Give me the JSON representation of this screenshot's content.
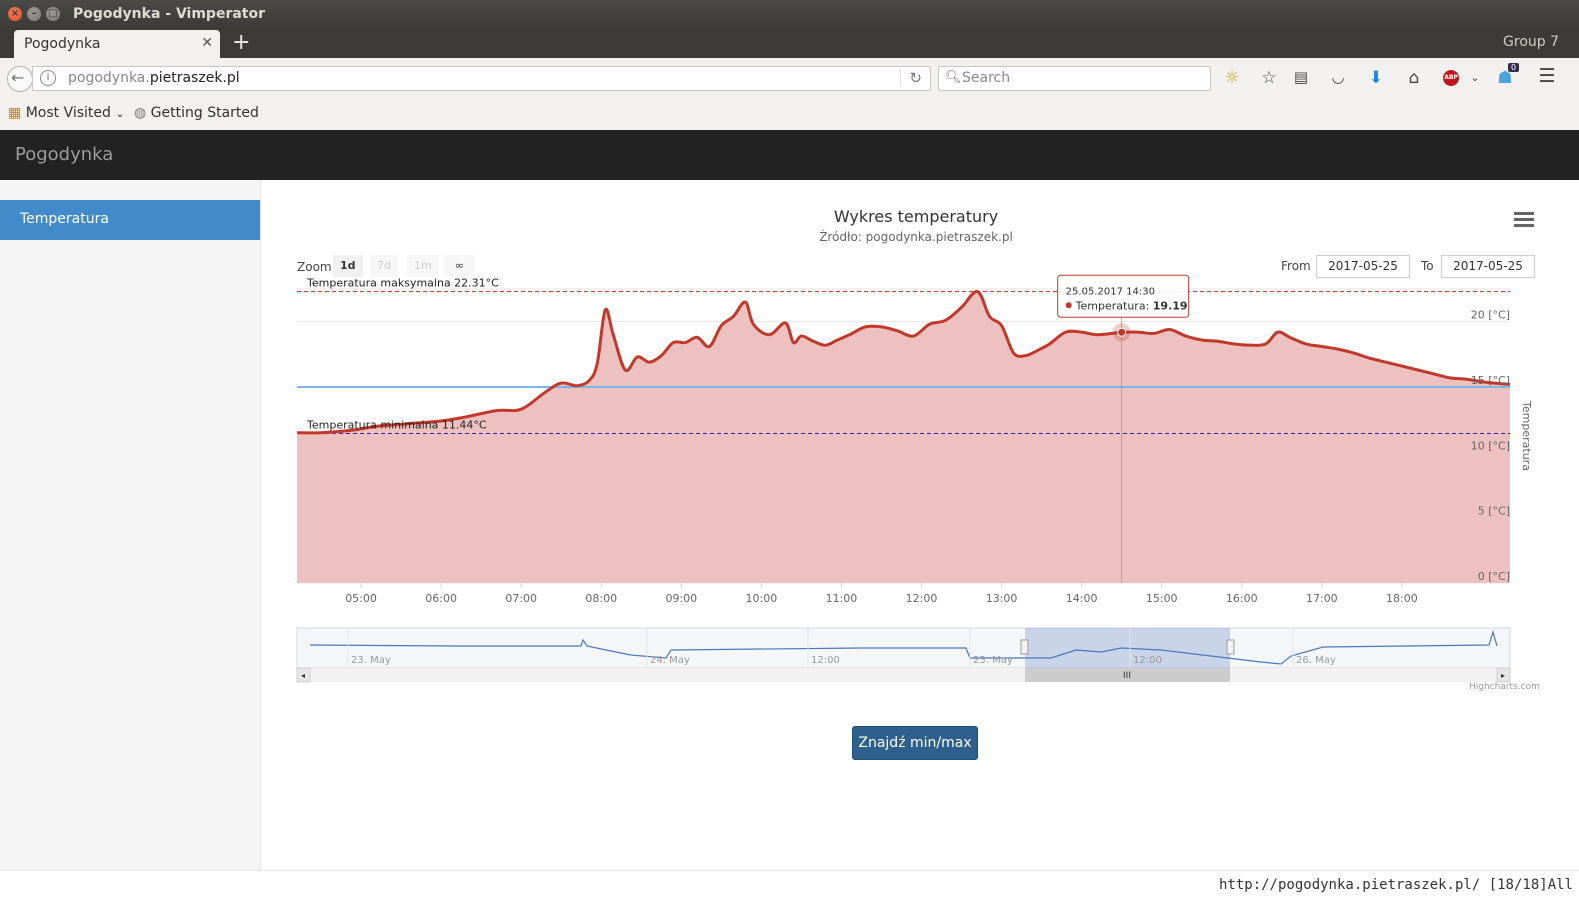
{
  "window": {
    "title": "Pogodynka - Vimperator"
  },
  "tabs": {
    "active_label": "Pogodynka",
    "group_label": "Group 7"
  },
  "nav": {
    "url_prefix": "pogodynka.",
    "url_domain": "pietraszek.pl",
    "search_placeholder": "Search",
    "downloads_badge": "0"
  },
  "bookmarks": {
    "most_visited": "Most Visited",
    "getting_started": "Getting Started"
  },
  "app": {
    "brand": "Pogodynka",
    "sidebar_items": [
      {
        "label": "Temperatura",
        "active": true
      }
    ],
    "find_button": "Znajdź min/max"
  },
  "chart_controls": {
    "zoom_label": "Zoom",
    "zoom_buttons": [
      "1d",
      "7d",
      "1m",
      "∞"
    ],
    "zoom_selected": "1d",
    "from_label": "From",
    "from_value": "2017-05-25",
    "to_label": "To",
    "to_value": "2017-05-25"
  },
  "chart_data": {
    "type": "area",
    "title": "Wykres temperatury",
    "subtitle": "Źródło: pogodynka.pietraszek.pl",
    "ylabel": "Temperatura",
    "ylim": [
      0,
      22.5
    ],
    "y_ticks": [
      "0 [°C]",
      "5 [°C]",
      "10 [°C]",
      "15 [°C]",
      "20 [°C]"
    ],
    "y_tick_values": [
      0,
      5,
      10,
      15,
      20
    ],
    "x_ticks": [
      "05:00",
      "06:00",
      "07:00",
      "08:00",
      "09:00",
      "10:00",
      "11:00",
      "12:00",
      "13:00",
      "14:00",
      "15:00",
      "16:00",
      "17:00",
      "18:00"
    ],
    "x_tick_values": [
      5,
      6,
      7,
      8,
      9,
      10,
      11,
      12,
      13,
      14,
      15,
      16,
      17,
      18
    ],
    "xlim": [
      4.2,
      19.35
    ],
    "grid": true,
    "colors": {
      "line": "#c0392b",
      "fill": "#ecc1bf",
      "average_line": "#7cb5ec",
      "max_line": "#c0392b",
      "min_line": "#3b1ca8"
    },
    "series": [
      {
        "x": [
          4.2,
          4.5,
          4.9,
          5.2,
          5.6,
          6.0,
          6.3,
          6.7,
          7.0,
          7.3,
          7.5,
          7.7,
          7.85,
          7.95,
          8.05,
          8.15,
          8.3,
          8.45,
          8.6,
          8.75,
          8.9,
          9.05,
          9.2,
          9.35,
          9.5,
          9.65,
          9.8,
          9.9,
          10.1,
          10.3,
          10.4,
          10.5,
          10.65,
          10.8,
          10.95,
          11.1,
          11.3,
          11.5,
          11.7,
          11.9,
          12.1,
          12.3,
          12.5,
          12.7,
          12.85,
          13.0,
          13.15,
          13.3,
          13.45,
          13.6,
          13.8,
          14.0,
          14.2,
          14.5,
          14.7,
          14.9,
          15.1,
          15.3,
          15.5,
          15.7,
          15.9,
          16.1,
          16.3,
          16.45,
          16.6,
          16.8,
          17.0,
          17.2,
          17.4,
          17.6,
          17.8,
          18.0,
          18.2,
          18.4,
          18.6,
          18.8,
          19.0,
          19.15,
          19.35
        ],
        "values": [
          11.5,
          11.5,
          11.7,
          12.0,
          12.2,
          12.4,
          12.7,
          13.2,
          13.3,
          14.6,
          15.3,
          15.1,
          15.5,
          16.8,
          20.9,
          19.0,
          16.3,
          17.3,
          16.9,
          17.4,
          18.4,
          18.4,
          18.8,
          18.1,
          19.7,
          20.4,
          21.5,
          19.8,
          19.0,
          19.9,
          18.4,
          18.9,
          18.5,
          18.2,
          18.6,
          19.0,
          19.6,
          19.6,
          19.3,
          18.9,
          19.8,
          20.1,
          21.1,
          22.3,
          20.4,
          19.7,
          17.6,
          17.4,
          17.8,
          18.3,
          19.2,
          19.2,
          19.0,
          19.19,
          19.2,
          19.1,
          19.4,
          18.9,
          18.6,
          18.5,
          18.3,
          18.2,
          18.3,
          19.2,
          18.8,
          18.3,
          18.1,
          17.9,
          17.6,
          17.2,
          16.9,
          16.6,
          16.3,
          16.0,
          15.7,
          15.6,
          15.4,
          15.3,
          15.2
        ]
      }
    ],
    "plot_lines": [
      {
        "label": "Temperatura maksymalna 22.31°C",
        "value": 22.31
      },
      {
        "label": "Temperatura minimalna 11.44°C",
        "value": 11.44
      },
      {
        "value": 15.0
      }
    ],
    "tooltip": {
      "date": "25.05.2017 14:30",
      "series": "Temperatura",
      "value": "19.19",
      "x": 14.5,
      "y": 19.19
    },
    "navigator": {
      "labels": [
        "23. May",
        "24. May",
        "12:00",
        "25. May",
        "12:00",
        "26. May"
      ]
    },
    "credits": "Highcharts.com"
  },
  "statusbar": {
    "text": "http://pogodynka.pietraszek.pl/ [18/18]All"
  }
}
